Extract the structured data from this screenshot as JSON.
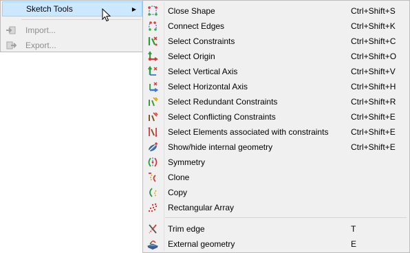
{
  "parent_menu": {
    "items": [
      {
        "label": "Sketch Tools",
        "icon": "none",
        "has_submenu": true,
        "highlighted": true
      },
      {
        "label": "Import...",
        "icon": "import-icon",
        "disabled": true
      },
      {
        "label": "Export...",
        "icon": "export-icon",
        "disabled": true
      }
    ]
  },
  "submenu": {
    "items": [
      {
        "label": "Close Shape",
        "shortcut": "Ctrl+Shift+S",
        "icon": "close-shape-icon"
      },
      {
        "label": "Connect Edges",
        "shortcut": "Ctrl+Shift+K",
        "icon": "connect-edges-icon"
      },
      {
        "label": "Select Constraints",
        "shortcut": "Ctrl+Shift+C",
        "icon": "select-constraints-icon"
      },
      {
        "label": "Select Origin",
        "shortcut": "Ctrl+Shift+O",
        "icon": "select-origin-icon"
      },
      {
        "label": "Select Vertical Axis",
        "shortcut": "Ctrl+Shift+V",
        "icon": "select-vertical-axis-icon"
      },
      {
        "label": "Select Horizontal Axis",
        "shortcut": "Ctrl+Shift+H",
        "icon": "select-horizontal-axis-icon"
      },
      {
        "label": "Select Redundant Constraints",
        "shortcut": "Ctrl+Shift+R",
        "icon": "select-redundant-constraints-icon"
      },
      {
        "label": "Select Conflicting Constraints",
        "shortcut": "Ctrl+Shift+E",
        "icon": "select-conflicting-constraints-icon"
      },
      {
        "label": "Select Elements associated with constraints",
        "shortcut": "Ctrl+Shift+E",
        "icon": "select-elements-associated-icon"
      },
      {
        "label": "Show/hide internal geometry",
        "shortcut": "Ctrl+Shift+E",
        "icon": "show-hide-internal-geometry-icon"
      },
      {
        "label": "Symmetry",
        "shortcut": "",
        "icon": "symmetry-icon"
      },
      {
        "label": "Clone",
        "shortcut": "",
        "icon": "clone-icon"
      },
      {
        "label": "Copy",
        "shortcut": "",
        "icon": "copy-icon"
      },
      {
        "label": "Rectangular Array",
        "shortcut": "",
        "icon": "rectangular-array-icon"
      },
      {
        "label": "Trim edge",
        "shortcut": "T",
        "icon": "trim-edge-icon"
      },
      {
        "label": "External geometry",
        "shortcut": "E",
        "icon": "external-geometry-icon"
      }
    ]
  }
}
